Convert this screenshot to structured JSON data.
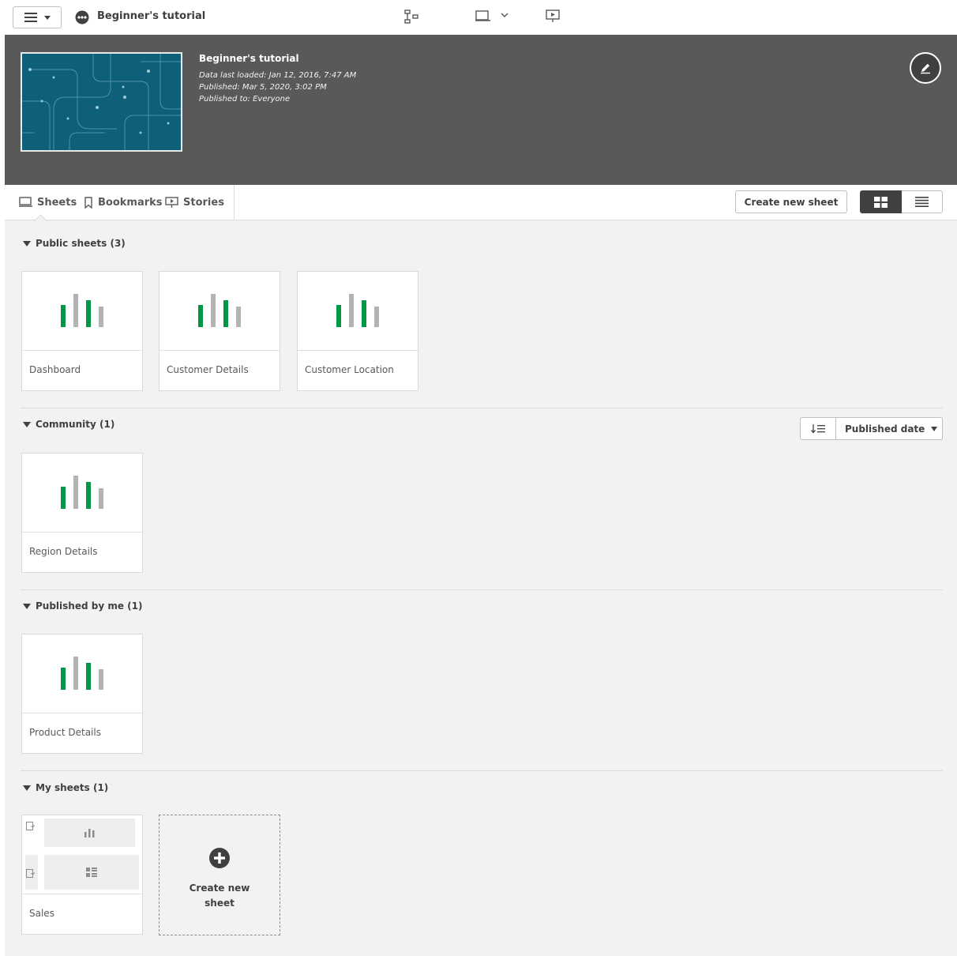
{
  "toolbar": {
    "app_title": "Beginner's tutorial"
  },
  "app_header": {
    "name": "Beginner's tutorial",
    "data_last_loaded": "Data last loaded: Jan 12, 2016, 7:47 AM",
    "published": "Published: Mar 5, 2020, 3:02 PM",
    "published_to": "Published to: Everyone"
  },
  "tabs": {
    "sheets": "Sheets",
    "bookmarks": "Bookmarks",
    "stories": "Stories"
  },
  "actions": {
    "create_new_sheet": "Create new sheet"
  },
  "sections": {
    "public": {
      "title": "Public sheets (3)",
      "sheets": [
        "Dashboard",
        "Customer Details",
        "Customer Location"
      ]
    },
    "community": {
      "title": "Community (1)",
      "sheets": [
        "Region Details"
      ],
      "sort_label": "Published date"
    },
    "published_by_me": {
      "title": "Published by me (1)",
      "sheets": [
        "Product Details"
      ]
    },
    "my_sheets": {
      "title": "My sheets (1)",
      "sheets": [
        "Sales"
      ],
      "create_card_line1": "Create new",
      "create_card_line2": "sheet"
    }
  },
  "colors": {
    "accent_green": "#009845",
    "bar_gray": "#b3b3b3",
    "header_bg": "#595959",
    "content_bg": "#f2f2f2"
  },
  "icons": {
    "menu": "hamburger-icon",
    "app": "app-icon",
    "sheet": "sheet-icon",
    "bookmark": "bookmark-icon",
    "story": "story-icon",
    "edit": "pencil-icon",
    "grid_view": "grid-view-icon",
    "list_view": "list-view-icon",
    "sort": "sort-order-icon",
    "add": "plus-circle-icon",
    "sheet_thumbnail": "bar-chart-thumbnail-icon"
  }
}
